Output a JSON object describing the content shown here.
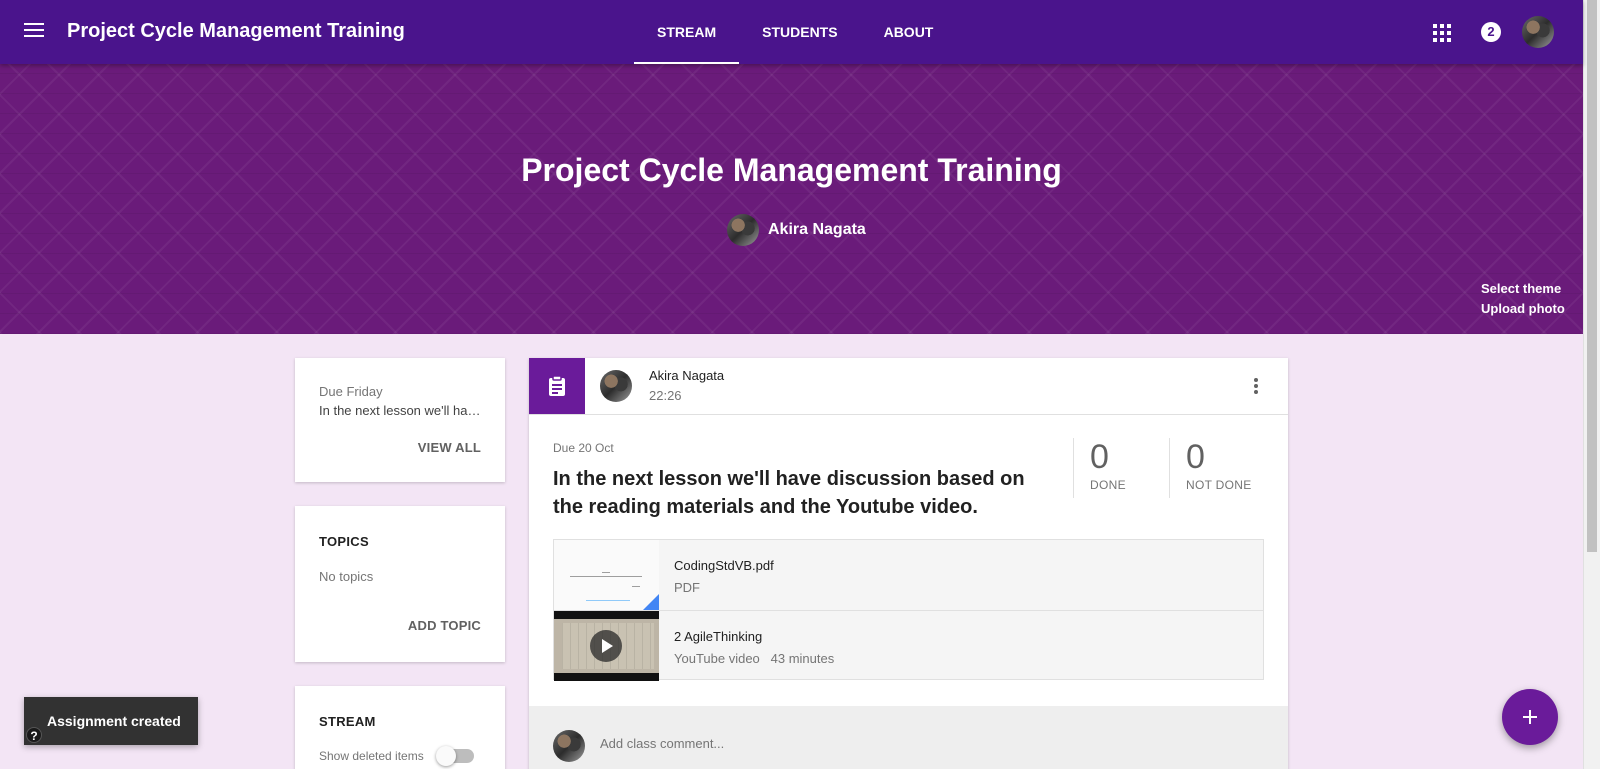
{
  "appbar": {
    "title": "Project Cycle Management Training",
    "tabs": [
      {
        "label": "STREAM",
        "active": true
      },
      {
        "label": "STUDENTS",
        "active": false
      },
      {
        "label": "ABOUT",
        "active": false
      }
    ],
    "notification_count": "2",
    "icons": [
      "menu-icon",
      "apps-grid-icon",
      "user-avatar"
    ]
  },
  "banner": {
    "title": "Project Cycle Management Training",
    "teacher": "Akira Nagata",
    "select_theme": "Select theme",
    "upload_photo": "Upload photo"
  },
  "upcoming": {
    "due": "Due Friday",
    "item": "In the next lesson we'll have discussion based on the reading materials and the Youtube video.",
    "view_all": "VIEW ALL"
  },
  "topics": {
    "heading": "TOPICS",
    "empty": "No topics",
    "add": "ADD TOPIC"
  },
  "stream_panel": {
    "heading": "STREAM",
    "show_deleted": "Show deleted items",
    "show_deleted_on": false
  },
  "post": {
    "author": "Akira Nagata",
    "time": "22:26",
    "due": "Due 20 Oct",
    "title": "In the next lesson we'll have discussion based on the reading materials and the Youtube video.",
    "done_count": "0",
    "done_label": "DONE",
    "not_done_count": "0",
    "not_done_label": "NOT DONE",
    "attachments": [
      {
        "name": "CodingStdVB.pdf",
        "type": "PDF",
        "duration": ""
      },
      {
        "name": "2 AgileThinking",
        "type": "YouTube video",
        "duration": "43 minutes"
      }
    ],
    "comment_placeholder": "Add class comment..."
  },
  "snackbar": {
    "message": "Assignment created"
  },
  "help_label": "?",
  "colors": {
    "appbar": "#4a148c",
    "banner": "#6a1b7a",
    "accent": "#6a1b9a",
    "background": "#f3e5f5"
  }
}
